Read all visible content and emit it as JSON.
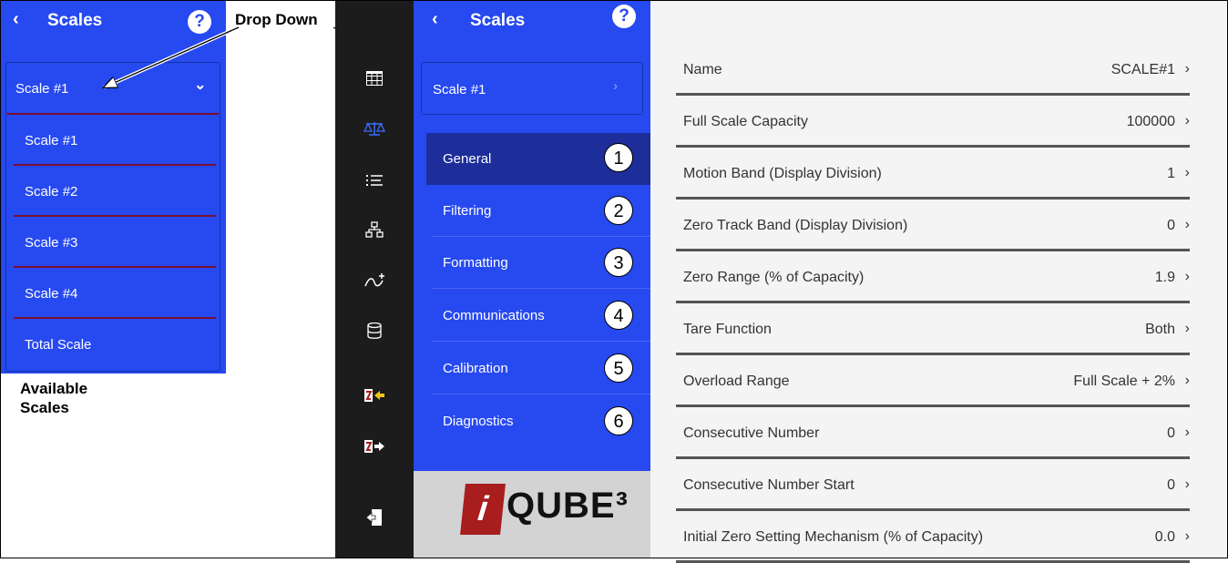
{
  "left_panel": {
    "back": "‹",
    "title": "Scales",
    "help": "?",
    "dropdown_value": "Scale #1",
    "dropdown_chevron": "⌄",
    "items": [
      {
        "label": "Scale #1"
      },
      {
        "label": "Scale #2"
      },
      {
        "label": "Scale #3"
      },
      {
        "label": "Scale #4"
      },
      {
        "label": "Total Scale"
      }
    ],
    "caption_line1": "Available",
    "caption_line2": "Scales"
  },
  "callout": "Drop Down",
  "sidebar": {
    "icons": [
      "grid-icon",
      "scale-icon",
      "list-icon",
      "network-icon",
      "transfer-icon",
      "database-icon",
      "import-icon",
      "export-icon",
      "logout-icon"
    ]
  },
  "menu": {
    "back": "‹",
    "title": "Scales",
    "help": "?",
    "dropdown_value": "Scale #1",
    "dropdown_chevron": "›",
    "items": [
      {
        "label": "General",
        "number": "1"
      },
      {
        "label": "Filtering",
        "number": "2"
      },
      {
        "label": "Formatting",
        "number": "3"
      },
      {
        "label": "Communications",
        "number": "4"
      },
      {
        "label": "Calibration",
        "number": "5"
      },
      {
        "label": "Diagnostics",
        "number": "6"
      }
    ]
  },
  "logo": {
    "i": "i",
    "text": "QUBE³"
  },
  "settings": [
    {
      "label": "Name",
      "value": "SCALE#1"
    },
    {
      "label": "Full Scale Capacity",
      "value": "100000"
    },
    {
      "label": "Motion Band (Display Division)",
      "value": "1"
    },
    {
      "label": "Zero Track Band (Display Division)",
      "value": "0"
    },
    {
      "label": "Zero Range (% of Capacity)",
      "value": "1.9"
    },
    {
      "label": "Tare Function",
      "value": "Both"
    },
    {
      "label": "Overload Range",
      "value": "Full Scale + 2%"
    },
    {
      "label": "Consecutive Number",
      "value": "0"
    },
    {
      "label": "Consecutive Number Start",
      "value": "0"
    },
    {
      "label": "Initial Zero Setting Mechanism (% of Capacity)",
      "value": "0.0"
    }
  ],
  "colors": {
    "accent": "#2749f0",
    "sidebar": "#1c1c1c",
    "active": "#1d2d9a",
    "separator": "#7a1030"
  }
}
